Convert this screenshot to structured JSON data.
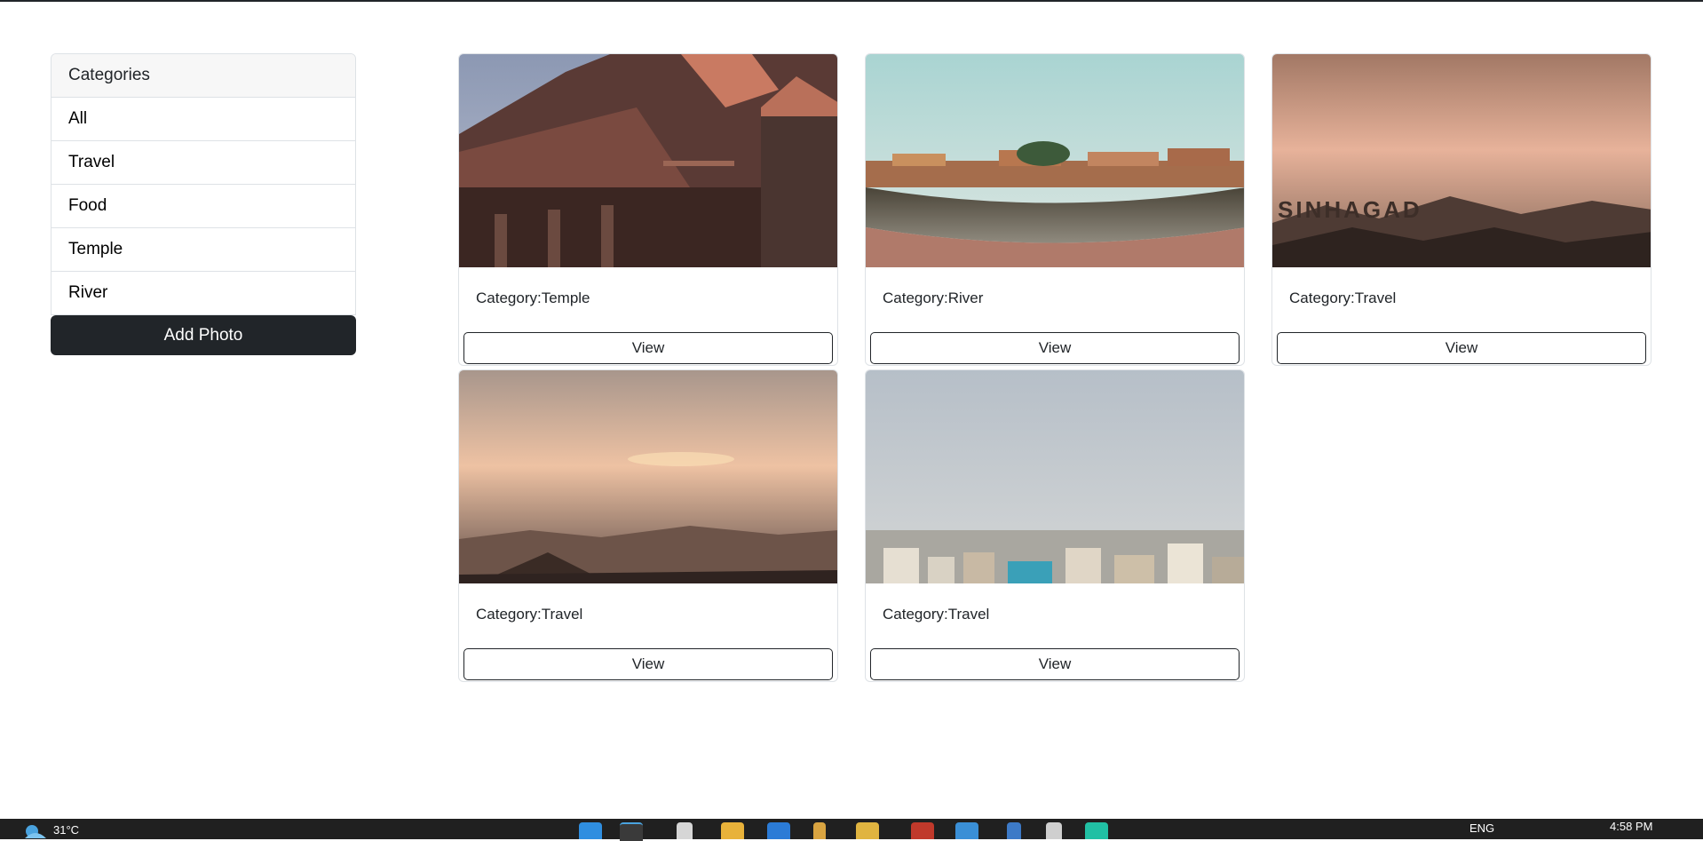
{
  "sidebar": {
    "header": "Categories",
    "items": [
      {
        "label": "All"
      },
      {
        "label": "Travel"
      },
      {
        "label": "Food"
      },
      {
        "label": "Temple"
      },
      {
        "label": "River"
      }
    ],
    "add_button": "Add Photo"
  },
  "cards": [
    {
      "category": "Category:Temple",
      "view": "View",
      "image": "temple-photo"
    },
    {
      "category": "Category:River",
      "view": "View",
      "image": "river-ghat-photo"
    },
    {
      "category": "Category:Travel",
      "view": "View",
      "image": "sinhagad-photo",
      "overlay_text": "SINHAGAD"
    },
    {
      "category": "Category:Travel",
      "view": "View",
      "image": "sunset-hills-photo"
    },
    {
      "category": "Category:Travel",
      "view": "View",
      "image": "city-skyline-photo"
    }
  ],
  "taskbar": {
    "temperature": "31°C",
    "language": "ENG",
    "time": "4:58 PM"
  },
  "colors": {
    "button_dark": "#212529",
    "border": "#dee2e6",
    "taskbar": "#202020"
  }
}
